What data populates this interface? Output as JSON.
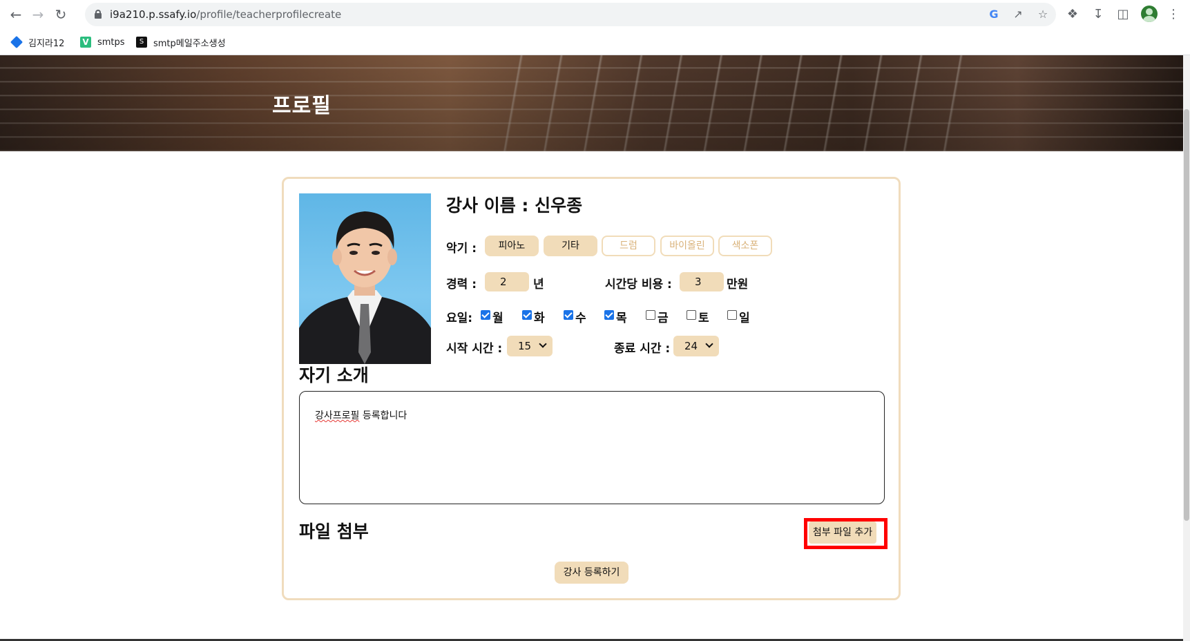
{
  "browser": {
    "url_host": "i9a210.p.ssafy.io",
    "url_path": "/profile/teacherprofilecreate",
    "bookmarks": [
      {
        "label": "김지라12",
        "icon": "jira-diamond-icon"
      },
      {
        "label": "smtps",
        "icon": "v-icon"
      },
      {
        "label": "smtp메일주소생성",
        "icon": "s-icon"
      }
    ]
  },
  "hero": {
    "title": "프로필"
  },
  "profile": {
    "name": "강사 이름 : 신우종",
    "instruments_label": "악기 :",
    "instruments": [
      {
        "label": "피아노",
        "selected": true
      },
      {
        "label": "기타",
        "selected": true
      },
      {
        "label": "드럼",
        "selected": false
      },
      {
        "label": "바이올린",
        "selected": false
      },
      {
        "label": "색소폰",
        "selected": false
      }
    ],
    "career_label": "경력 :",
    "career_value": "2",
    "career_unit": "년",
    "fee_label": "시간당 비용 :",
    "fee_value": "3",
    "fee_unit": "만원",
    "days_label": "요일:",
    "days": [
      {
        "label": "월",
        "checked": true
      },
      {
        "label": "화",
        "checked": true
      },
      {
        "label": "수",
        "checked": true
      },
      {
        "label": "목",
        "checked": true
      },
      {
        "label": "금",
        "checked": false
      },
      {
        "label": "토",
        "checked": false
      },
      {
        "label": "일",
        "checked": false
      }
    ],
    "start_label": "시작 시간 :",
    "start_value": "15",
    "end_label": "종료 시간 :",
    "end_value": "24"
  },
  "intro": {
    "title": "자기 소개",
    "text_misspelled": "강사프로필",
    "text_rest": " 등록합니다"
  },
  "attachment": {
    "title": "파일 첨부",
    "add_button": "첨부 파일 추가"
  },
  "submit_button": "강사 등록하기",
  "colors": {
    "accent": "#f1dcb9",
    "card_border": "#f0dcbd",
    "highlight": "#ff0000",
    "checkbox": "#1a73e8"
  }
}
